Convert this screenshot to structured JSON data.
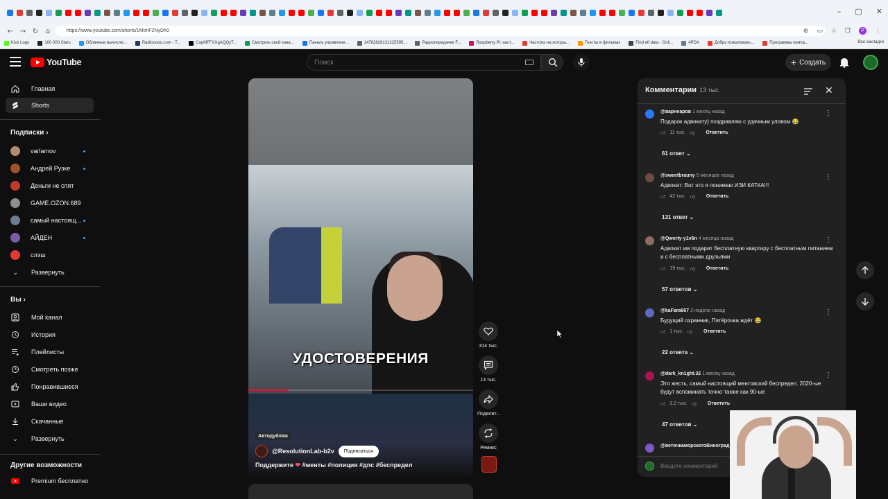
{
  "browser": {
    "url": "https://www.youtube.com/shorts/1MtmF2NyDh0",
    "bookmarks": [
      "Kick Logo",
      "100 000 Stars",
      "Облачные вычисле...",
      "Radiooooo.com - T...",
      "CopMFFXXgAQQyT...",
      "Смотреть свой кана...",
      "Панель управлени...",
      "14762826131225595...",
      "Радиопередачик F...",
      "Raspberry Pi: наст...",
      "Частоты на которы...",
      "Тексты в фильмах",
      "Find elf data - Onli...",
      "4PDA",
      "Добро пожаловать...",
      "Программы компа..."
    ],
    "all_bookmarks": "Все закладки",
    "profile_initial": "P"
  },
  "header": {
    "logo": "YouTube",
    "search_placeholder": "Поиск",
    "create_label": "Создать"
  },
  "sidebar": {
    "main": [
      {
        "label": "Главная",
        "icon": "home-icon"
      },
      {
        "label": "Shorts",
        "icon": "shorts-icon",
        "active": true
      }
    ],
    "subscriptions_title": "Подписки",
    "subscriptions": [
      {
        "label": "varlamov",
        "color": "#b88b6a"
      },
      {
        "label": "Андрей Рузке",
        "color": "#a0522d"
      },
      {
        "label": "Деньги не спят",
        "color": "#c0392b"
      },
      {
        "label": "GAME.OZON.689",
        "color": "#8e8e8e"
      },
      {
        "label": "самый настоящ...",
        "color": "#6b7c8c"
      },
      {
        "label": "АЙДЕН",
        "color": "#7d5ba6"
      },
      {
        "label": "слэш",
        "color": "#e53935"
      }
    ],
    "expand_label": "Развернуть",
    "you_title": "Вы",
    "you_items": [
      {
        "label": "Мой канал",
        "icon": "channel-icon"
      },
      {
        "label": "История",
        "icon": "history-icon"
      },
      {
        "label": "Плейлисты",
        "icon": "playlist-icon"
      },
      {
        "label": "Смотреть позже",
        "icon": "clock-icon"
      },
      {
        "label": "Понравившиеся",
        "icon": "like-icon"
      },
      {
        "label": "Ваши видео",
        "icon": "video-icon"
      },
      {
        "label": "Скачанные",
        "icon": "download-icon"
      },
      {
        "label": "Развернуть",
        "icon": "chevron-down-icon"
      }
    ],
    "other_title": "Другие возможности",
    "premium_label": "Premium бесплатно"
  },
  "short": {
    "caption": "УДОСТОВЕРЕНИЯ",
    "progress": 0.18,
    "tag": "Автодубляж",
    "channel": "@ResolutionLab-b2v",
    "subscribe_label": "Подписаться",
    "title_prefix": "Поддержите",
    "title_heart": "❤",
    "title_tags": "#менты #полиция #дпс #беспредел",
    "likes": "314 тыс.",
    "comments": "13 тыс.",
    "share_label": "Поделит...",
    "remix_label": "Ремикс"
  },
  "comments_panel": {
    "title": "Комментарии",
    "count": "13 тыс.",
    "reply_label": "Ответить",
    "input_placeholder": "Введите комментарий",
    "items": [
      {
        "author": "@варнеаров",
        "time": "1 месяц назад",
        "text": "Подарок адвокату) поздравляю с удачным уловом 😂",
        "likes": "11 тыс.",
        "replies": "61 ответ",
        "avatar": "#2979ff"
      },
      {
        "author": "@sweetbrauny",
        "time": "5 месяцев назад",
        "text": "Адвокат: Вот это я понимаю ИЗИ КАТКА!!!",
        "likes": "42 тыс.",
        "replies": "131 ответ",
        "avatar": "#6d4c41"
      },
      {
        "author": "@Qwerty-y1v6n",
        "time": "4 месяца назад",
        "text": "Адвокат им подарит бесплатную квартиру с бесплатным питанием и с бесплатными друзьями",
        "likes": "19 тыс.",
        "replies": "57 ответов",
        "avatar": "#8d6e63"
      },
      {
        "author": "@kaFara667",
        "time": "2 недели назад",
        "text": "Будущий охранник, Пятёрочка ждёт 😂",
        "likes": "1 тыс.",
        "replies": "22 ответа",
        "avatar": "#5c6bc0"
      },
      {
        "author": "@dark_kn1ght.32",
        "time": "1 месяц назад",
        "text": "Это жесть, самый настоящий ментовский беспредел. 2020-ые будут вспоминать точно также как 90-ые",
        "likes": "3,2 тыс.",
        "replies": "47 ответов",
        "avatar": "#ad1457"
      },
      {
        "author": "@веточкаморскогоВиноград",
        "time": "",
        "text": "",
        "likes": "",
        "replies": "",
        "avatar": "#7e57c2"
      }
    ]
  },
  "colors": {
    "accent": "#ff0000",
    "link": "#3ea6ff",
    "bg": "#0f0f0f",
    "panel": "#212121"
  }
}
